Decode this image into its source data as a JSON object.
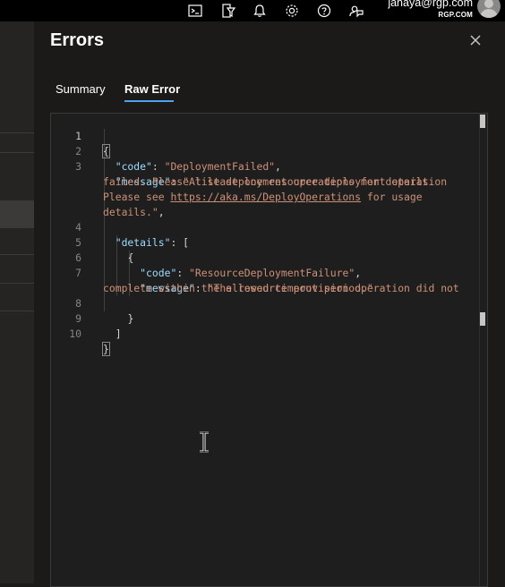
{
  "header": {
    "user_name": "janaya@rgp.com",
    "user_org": "RGP.COM",
    "icons": [
      "cloud-shell-icon",
      "directory-filter-icon",
      "notifications-icon",
      "settings-icon",
      "help-icon",
      "feedback-icon"
    ]
  },
  "blade": {
    "title": "Errors",
    "tabs": [
      {
        "label": "Summary",
        "active": false
      },
      {
        "label": "Raw Error",
        "active": true
      }
    ]
  },
  "editor": {
    "line_numbers": [
      "1",
      "2",
      "3",
      "",
      "",
      "",
      "4",
      "5",
      "6",
      "7",
      "",
      "8",
      "9",
      "10"
    ],
    "json_text": {
      "l1_open": "{",
      "code_key": "\"code\"",
      "code_val": "\"DeploymentFailed\"",
      "message_key": "\"message\"",
      "message_val_1": "\"At least one resource deployment operation",
      "message_val_2": "failed. Please list deployment operations for details.",
      "message_val_3a": "Please see ",
      "message_link": "https://aka.ms/DeployOperations",
      "message_val_3b": " for usage",
      "message_val_4": "details.\"",
      "details_key": "\"details\"",
      "details_open": "[",
      "obj_open": "{",
      "inner_code_key": "\"code\"",
      "inner_code_val": "\"ResourceDeploymentFailure\"",
      "inner_message_key": "\"message\"",
      "inner_message_val_1": "\"The resource provision operation did not",
      "inner_message_val_2": "complete within the allowed timeout period.\"",
      "obj_close": "}",
      "details_close": "]",
      "l10_close": "}"
    }
  },
  "colors": {
    "json_key": "#9cdcfe",
    "json_string": "#ce9178",
    "tab_underline": "#4ca3f2"
  }
}
